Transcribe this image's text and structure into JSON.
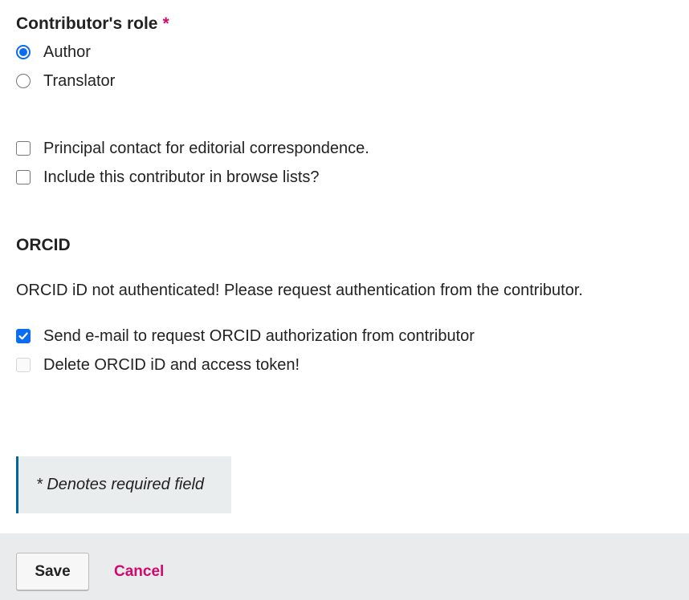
{
  "role_section": {
    "heading": "Contributor's role",
    "required_marker": "*",
    "options": [
      {
        "label": "Author",
        "checked": true
      },
      {
        "label": "Translator",
        "checked": false
      }
    ]
  },
  "contact_options": [
    {
      "label": "Principal contact for editorial correspondence.",
      "checked": false
    },
    {
      "label": "Include this contributor in browse lists?",
      "checked": false
    }
  ],
  "orcid": {
    "heading": "ORCID",
    "status_text": "ORCID iD not authenticated! Please request authentication from the contributor.",
    "options": [
      {
        "label": "Send e-mail to request ORCID authorization from contributor",
        "checked": true,
        "disabled": false
      },
      {
        "label": "Delete ORCID iD and access token!",
        "checked": false,
        "disabled": true
      }
    ]
  },
  "required_notice": "* Denotes required field",
  "footer": {
    "save_label": "Save",
    "cancel_label": "Cancel"
  },
  "colors": {
    "accent_blue": "#0b6cf0",
    "required_pink": "#d00a6c",
    "notice_border": "#006798",
    "footer_bg": "#e9ebed"
  }
}
